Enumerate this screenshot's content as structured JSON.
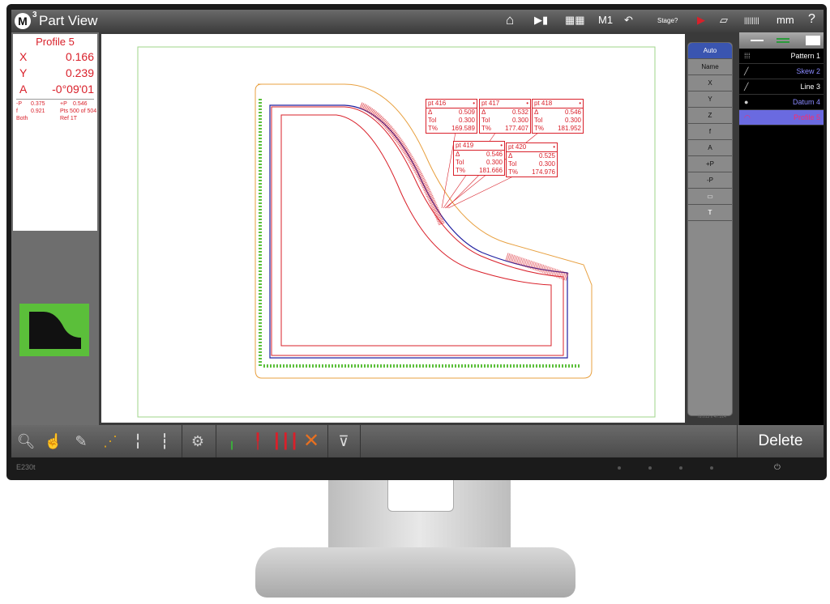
{
  "window": {
    "title": "Part View",
    "logo": "M",
    "logo_sup": "3"
  },
  "topbar": {
    "icons": [
      "home-icon",
      "video-icon",
      "table-icon",
      "undo-icon",
      "probe-icon",
      "stage-icon",
      "ruler-icon"
    ],
    "m1": "M1",
    "stage": "Stage?",
    "units": "mm",
    "help": "?"
  },
  "readout": {
    "feature": "Profile 5",
    "x_label": "X",
    "x": "0.166",
    "y_label": "Y",
    "y": "0.239",
    "a_label": "A",
    "a": "-0°09'01",
    "details": [
      [
        "-P",
        "0.375",
        "+P",
        "0.546"
      ],
      [
        "f",
        "0.921",
        "Pts 500 of 504",
        ""
      ],
      [
        "Both",
        "",
        "Ref 1T",
        ""
      ]
    ]
  },
  "annotations": [
    {
      "name": "pt 416",
      "delta": "0.509",
      "tol": "0.300",
      "tpct": "169.589"
    },
    {
      "name": "pt 417",
      "delta": "0.532",
      "tol": "0.300",
      "tpct": "177.407"
    },
    {
      "name": "pt 418",
      "delta": "0.546",
      "tol": "0.300",
      "tpct": "181.952"
    },
    {
      "name": "pt 419",
      "delta": "0.546",
      "tol": "0.300",
      "tpct": "181.666"
    },
    {
      "name": "pt 420",
      "delta": "0.525",
      "tol": "0.300",
      "tpct": "174.976"
    }
  ],
  "ann_labels": {
    "delta": "Δ",
    "tol": "Tol",
    "tpct": "T%"
  },
  "column_buttons": [
    "Auto",
    "Name",
    "X",
    "Y",
    "Z",
    "f",
    "A",
    "+P",
    "-P",
    "▭",
    "T"
  ],
  "coord_readout": "78.013 x 47.314",
  "features": [
    {
      "label": "Pattern 1",
      "icon": "pattern-icon",
      "color": "#ffffff"
    },
    {
      "label": "Skew 2",
      "icon": "line-icon",
      "color": "#8a8aff"
    },
    {
      "label": "Line 3",
      "icon": "line-icon",
      "color": "#ffffff"
    },
    {
      "label": "Datum 4",
      "icon": "dot-icon",
      "color": "#8a8aff"
    },
    {
      "label": "Profile 5",
      "icon": "arc-icon",
      "color": "#ff2a6a",
      "selected": true
    }
  ],
  "toolbar": {
    "delete_label": "Delete"
  },
  "monitor": {
    "model": "E230t"
  },
  "colors": {
    "accent": "#3a55b0",
    "readout": "#d9202a",
    "selected": "#6a6ae0",
    "tolerance_green": "#5bbf3a"
  }
}
